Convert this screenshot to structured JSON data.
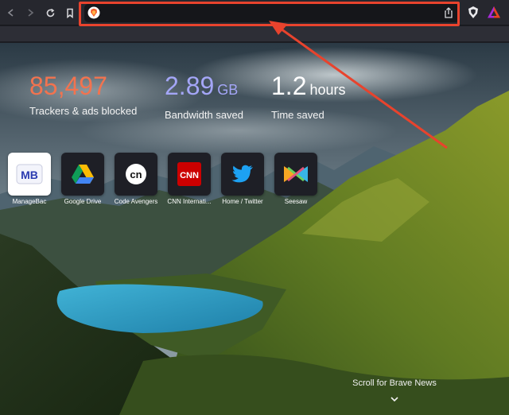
{
  "stats": {
    "trackers": {
      "value": "85,497",
      "label": "Trackers & ads blocked",
      "color": "#f2734f"
    },
    "bandwidth": {
      "value": "2.89",
      "unit": "GB",
      "label": "Bandwidth saved",
      "color": "#a4a6f7"
    },
    "time": {
      "value": "1.2",
      "unit": "hours",
      "label": "Time saved",
      "color": "#ffffff"
    }
  },
  "tiles": [
    {
      "label": "ManageBac"
    },
    {
      "label": "Google Drive"
    },
    {
      "label": "Code Avengers"
    },
    {
      "label": "CNN Internati..."
    },
    {
      "label": "Home / Twitter"
    },
    {
      "label": "Seesaw"
    }
  ],
  "tile_text": {
    "managebac": "MB",
    "code": "cn",
    "cnn": "CNN"
  },
  "news": {
    "label": "Scroll for Brave News"
  },
  "colors": {
    "highlight": "#e8432d",
    "toolbar": "#26272e"
  }
}
